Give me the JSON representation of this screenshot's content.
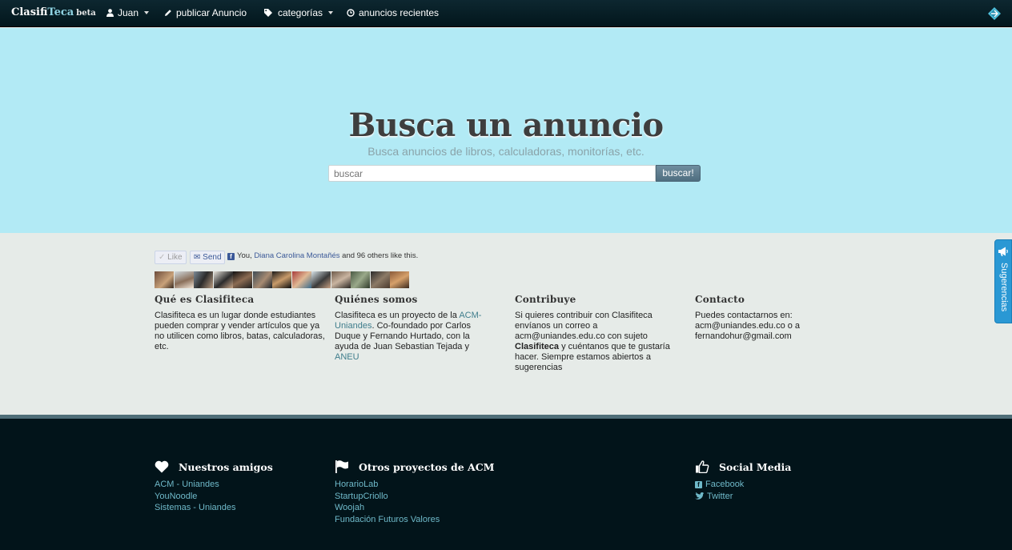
{
  "navbar": {
    "brand_main": "Clasifi",
    "brand_accent": "Teca",
    "brand_beta": "beta",
    "user_label": "Juan",
    "publish_label": "publicar Anuncio",
    "categories_label": "categorías",
    "recent_label": "anuncios recientes"
  },
  "hero": {
    "title": "Busca un anuncio",
    "subtitle": "Busca anuncios de libros, calculadoras, monitorías, etc.",
    "search_placeholder": "buscar",
    "search_button": "buscar!"
  },
  "facebook": {
    "like_label": "Like",
    "send_label": "Send",
    "text_prefix": "You, ",
    "friend_name": "Diana Carolina Montañés",
    "text_suffix": " and 96 others like this."
  },
  "info": {
    "about_title": "Qué es Clasifiteca",
    "about_text": "Clasifiteca es un lugar donde estudiantes pueden comprar y vender artículos que ya no utilicen como libros, batas, calculadoras, etc.",
    "who_title": "Quiénes somos",
    "who_text_1": "Clasifiteca es un proyecto de la ",
    "who_link_1": "ACM-Uniandes",
    "who_text_2": ". Co-foundado por Carlos Duque y Fernando Hurtado, con la ayuda de Juan Sebastian Tejada y ",
    "who_link_2": "ANEU",
    "contrib_title": "Contribuye",
    "contrib_text_1": "Si quieres contribuir con Clasifiteca envíanos un correo a acm@uniandes.edu.co con sujeto ",
    "contrib_bold": "Clasifiteca",
    "contrib_text_2": " y cuéntanos que te gustaría hacer. Siempre estamos abiertos a sugerencias",
    "contact_title": "Contacto",
    "contact_text": "Puedes contactarnos en: acm@uniandes.edu.co o a fernandohur@gmail.com"
  },
  "footer": {
    "friends_title": "Nuestros amigos",
    "friends": [
      "ACM - Uniandes",
      "YouNoodle",
      "Sistemas - Uniandes"
    ],
    "projects_title": "Otros proyectos de ACM",
    "projects": [
      "HorarioLab",
      "StartupCriollo",
      "Woojah",
      "Fundación Futuros Valores"
    ],
    "social_title": "Social Media",
    "social": [
      "Facebook",
      "Twitter"
    ]
  },
  "side_tab": {
    "label": "Sugerencias"
  },
  "colors": {
    "hero_bg": "#b2eaf5",
    "navbar_bg": "#02161c",
    "footer_bg": "#02141a",
    "link": "#3f7d8c",
    "footer_link": "#6fb9c9",
    "side_tab": "#2a98d4"
  }
}
